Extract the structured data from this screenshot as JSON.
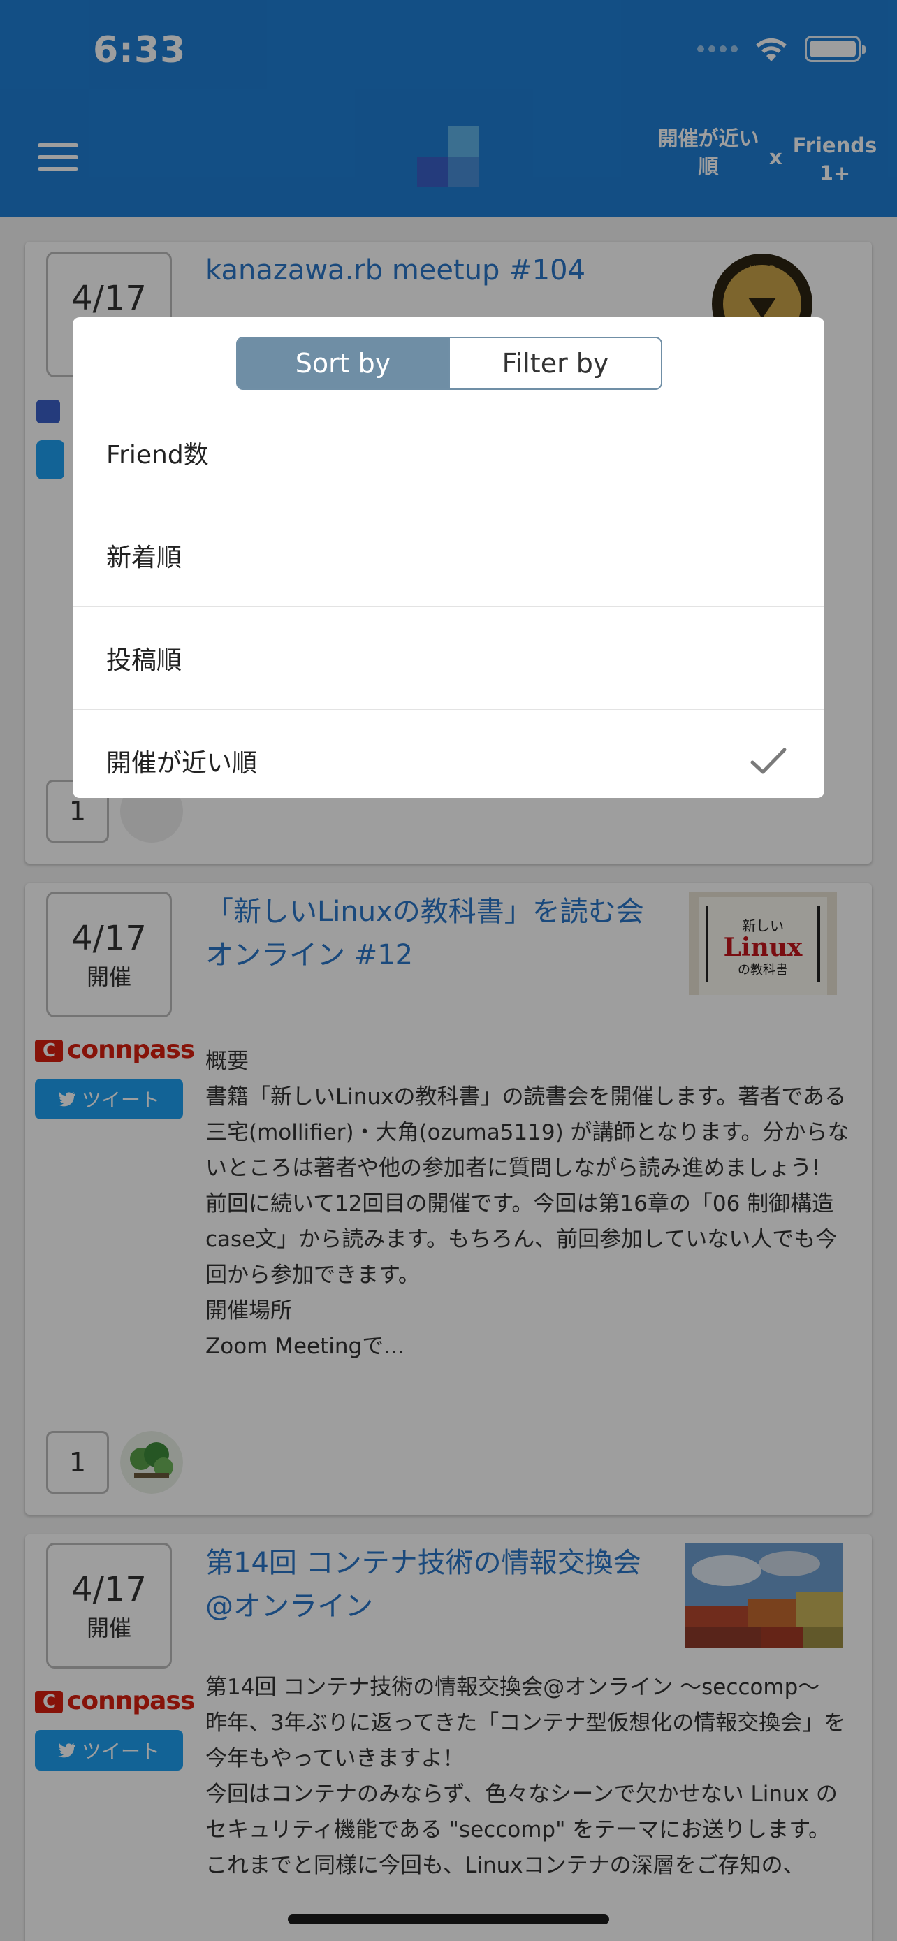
{
  "status_bar": {
    "time": "6:33"
  },
  "nav": {
    "sort_label": "開催が近い順",
    "separator": "x",
    "filter_label": "Friends 1+"
  },
  "events": [
    {
      "date": "4/17",
      "title": "kanazawa.rb meetup #104",
      "count": "1"
    },
    {
      "date": "4/17",
      "held": "開催",
      "title": "「新しいLinuxの教科書」を読む会 オンライン #12",
      "source": "connpass",
      "tweet_label": "ツイート",
      "description_lines": [
        "概要",
        "書籍「新しいLinuxの教科書」の読書会を開催します。著者である 三宅(mollifier)・大角(ozuma5119) が講師となります。分からないところは著者や他の参加者に質問しながら読み進めましょう!",
        "前回に続いて12回目の開催です。今回は第16章の「06 制御構造 case文」から読みます。もちろん、前回参加していない人でも今回から参加できます。",
        "開催場所",
        "Zoom Meetingで..."
      ],
      "count": "1"
    },
    {
      "date": "4/17",
      "held": "開催",
      "title": "第14回 コンテナ技術の情報交換会@オンライン",
      "source": "connpass",
      "tweet_label": "ツイート",
      "description_lines": [
        "第14回 コンテナ技術の情報交換会@オンライン 〜seccomp〜",
        "昨年、3年ぶりに返ってきた「コンテナ型仮想化の情報交換会」を今年もやっていきますよ！",
        "今回はコンテナのみならず、色々なシーンで欠かせない Linux のセキュリティ機能である \"seccomp\" をテーマにお送りします。",
        "これまでと同様に今回も、Linuxコンテナの深層をご存知の、"
      ]
    }
  ],
  "modal": {
    "tabs": [
      {
        "label": "Sort by",
        "active": true
      },
      {
        "label": "Filter by",
        "active": false
      }
    ],
    "options": [
      {
        "label": "Friend数",
        "selected": false
      },
      {
        "label": "新着順",
        "selected": false
      },
      {
        "label": "投稿順",
        "selected": false
      },
      {
        "label": "開催が近い順",
        "selected": true
      }
    ]
  },
  "colors": {
    "nav_bg": "#1f7fd6",
    "link": "#2a77c9",
    "tweet": "#1da1f2",
    "segment_active": "#6f8ea5",
    "connpass_red": "#d9200f"
  }
}
